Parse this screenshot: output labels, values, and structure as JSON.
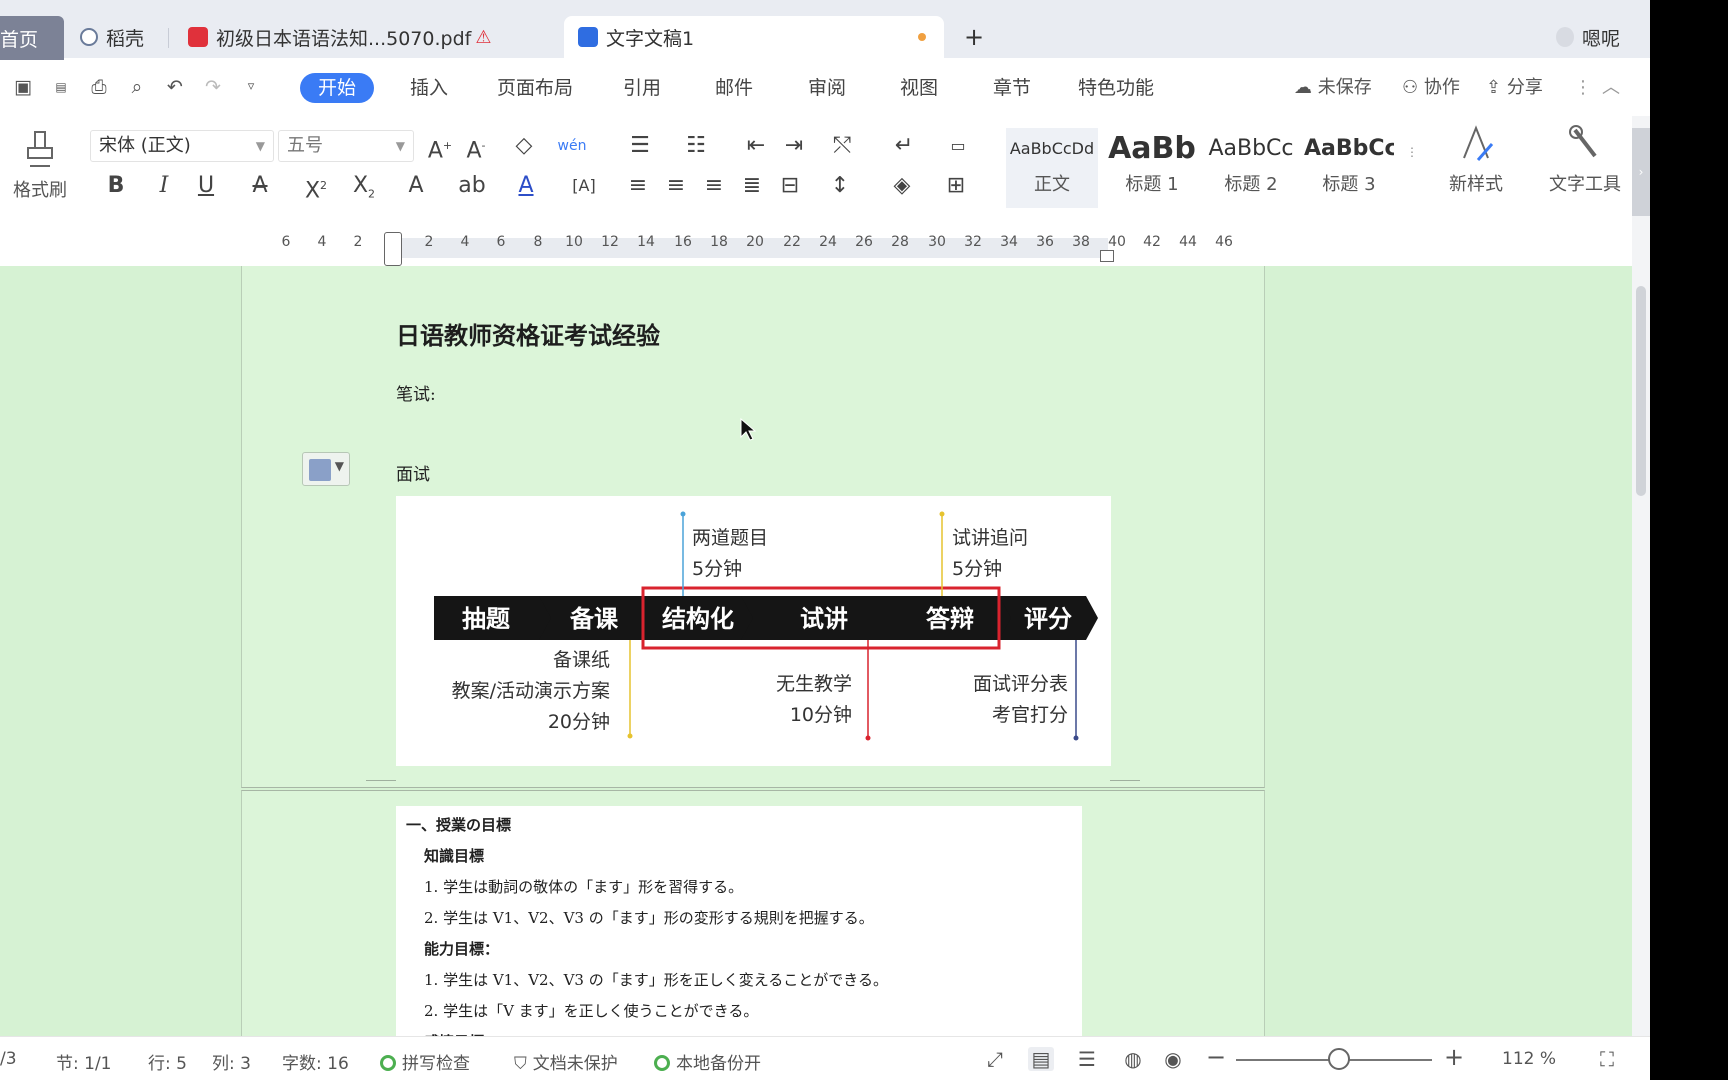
{
  "tabs": {
    "home": "首页",
    "daoke": "稻壳",
    "pdf": "初级日本语语法知...5070.pdf",
    "doc": "文字文稿1",
    "add": "+",
    "user": "嗯呢"
  },
  "menu": {
    "items": [
      "开始",
      "插入",
      "页面布局",
      "引用",
      "邮件",
      "审阅",
      "视图",
      "章节",
      "特色功能"
    ],
    "unsaved": "未保存",
    "collab": "协作",
    "share": "分享"
  },
  "ribbon": {
    "format_brush": "格式刷",
    "font_name": "宋体 (正文)",
    "font_size": "五号",
    "styles": [
      {
        "sample": "AaBbCcDd",
        "name": "正文"
      },
      {
        "sample": "AaBb",
        "name": "标题 1"
      },
      {
        "sample": "AaBbCc",
        "name": "标题 2"
      },
      {
        "sample": "AaBbCc",
        "name": "标题 3"
      }
    ],
    "new_style": "新样式",
    "text_tool": "文字工具"
  },
  "ruler": {
    "numbers": [
      "6",
      "4",
      "2",
      "2",
      "4",
      "6",
      "8",
      "10",
      "12",
      "14",
      "16",
      "18",
      "20",
      "22",
      "24",
      "26",
      "28",
      "30",
      "32",
      "34",
      "36",
      "38",
      "40",
      "42",
      "44",
      "46"
    ]
  },
  "document": {
    "title": "日语教师资格证考试经验",
    "written": "笔试:",
    "interview": "面试",
    "diagram": {
      "steps": [
        "抽题",
        "备课",
        "结构化",
        "试讲",
        "答辩",
        "评分"
      ],
      "top_left_line1": "两道题目",
      "top_left_line2": "5分钟",
      "top_right_line1": "试讲追问",
      "top_right_line2": "5分钟",
      "bottom_left_line1": "备课纸",
      "bottom_left_line2": "教案/活动演示方案",
      "bottom_left_line3": "20分钟",
      "bottom_mid_line1": "无生教学",
      "bottom_mid_line2": "10分钟",
      "bottom_right_line1": "面试评分表",
      "bottom_right_line2": "考官打分"
    },
    "page2_lines": [
      {
        "text": "一、授業の目標",
        "bold": true
      },
      {
        "text": "知識目標",
        "bold": true
      },
      {
        "text": "1. 学生は動詞の敬体の「ます」形を習得する。",
        "bold": false
      },
      {
        "text": "2. 学生は V1、V2、V3 の「ます」形の変形する規則を把握する。",
        "bold": false
      },
      {
        "text": "能力目標：",
        "bold": true
      },
      {
        "text": "1. 学生は V1、V2、V3 の「ます」形を正しく変えることができる。",
        "bold": false
      },
      {
        "text": "2. 学生は「V ます」を正しく使うことができる。",
        "bold": false
      },
      {
        "text": "感情目標：",
        "bold": true
      }
    ]
  },
  "status": {
    "page": "/3",
    "section": "节: 1/1",
    "row": "行: 5",
    "col": "列: 3",
    "words": "字数: 16",
    "spell": "拼写检查",
    "protect": "文档未保护",
    "backup": "本地备份开",
    "zoom": "112 %",
    "zoom_minus": "−",
    "zoom_plus": "+"
  },
  "colors": {
    "accent": "#3a7bf5",
    "canvas_bg": "#d6f2d3",
    "highlight_box": "#d9232e"
  }
}
